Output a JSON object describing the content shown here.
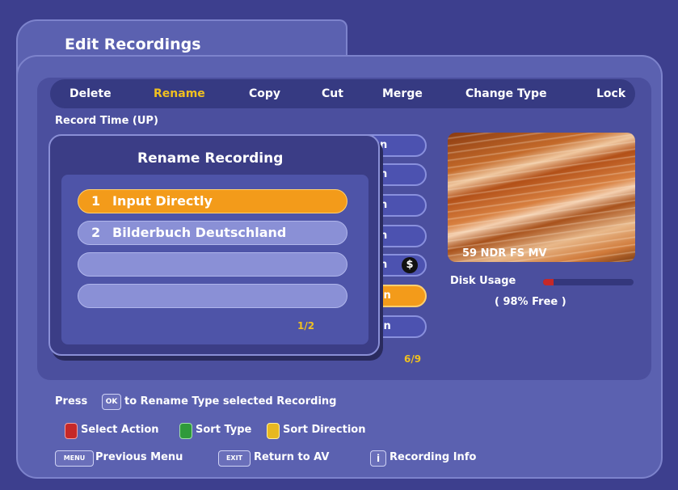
{
  "header": {
    "title": "Edit Recordings"
  },
  "actions": [
    {
      "label": "Delete"
    },
    {
      "label": "Rename",
      "selected": true
    },
    {
      "label": "Copy"
    },
    {
      "label": "Cut"
    },
    {
      "label": "Merge"
    },
    {
      "label": "Change Type"
    },
    {
      "label": "Lock"
    }
  ],
  "sort_label": "Record Time (UP)",
  "list_fragments": [
    "n",
    "n",
    "n",
    "n",
    "n",
    "in",
    "in"
  ],
  "list_page": "6/9",
  "dialog": {
    "title": "Rename Recording",
    "options": [
      {
        "num": "1",
        "label": "Input Directly"
      },
      {
        "num": "2",
        "label": "Bilderbuch Deutschland"
      },
      {
        "num": "",
        "label": ""
      },
      {
        "num": "",
        "label": ""
      }
    ],
    "page": "1/2"
  },
  "preview": {
    "channel": "59 NDR FS MV"
  },
  "disk": {
    "label": "Disk Usage",
    "used_fraction": 0.02,
    "free_text": "( 98% Free )"
  },
  "footer": {
    "press": "Press",
    "ok_key": "OK",
    "ok_hint": "to Rename Type selected Recording",
    "select_action": "Select Action",
    "sort_type": "Sort Type",
    "sort_direction": "Sort Direction",
    "menu_key": "MENU",
    "previous_menu": "Previous Menu",
    "exit_key": "EXIT",
    "return_av": "Return to AV",
    "info_key": "i",
    "recording_info": "Recording Info"
  },
  "colors": {
    "highlight": "#f39b1a",
    "panel": "#5b61b0",
    "background": "#3d3f8e",
    "accent_text": "#f0c020"
  }
}
